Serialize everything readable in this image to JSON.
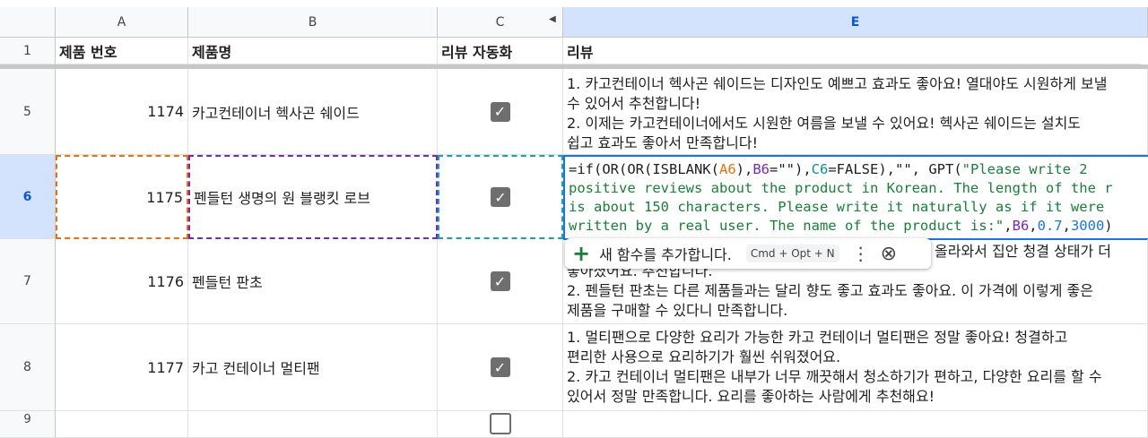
{
  "columns": {
    "a": "A",
    "b": "B",
    "c": "C",
    "e": "E"
  },
  "header_row": {
    "num": "1",
    "product_no": "제품 번호",
    "product_name": "제품명",
    "auto_review": "리뷰 자동화",
    "review": "리뷰"
  },
  "rows": [
    {
      "num": "5",
      "product_no": "1174",
      "product_name": "카고컨테이너 헥사곤 쉐이드",
      "checked": true,
      "review_lines": [
        "1. 카고컨테이너 헥사곤 쉐이드는 디자인도 예쁘고 효과도 좋아요! 열대야도 시원하게 보낼",
        "수 있어서 추천합니다!",
        "2. 이제는 카고컨테이너에서도 시원한 여름을 보낼 수 있어요! 헥사곤 쉐이드는 설치도",
        "쉽고 효과도 좋아서 만족합니다!"
      ]
    },
    {
      "num": "6",
      "product_no": "1175",
      "product_name": "펜들턴 생명의 원 블랭킷 로브",
      "checked": true
    },
    {
      "num": "7",
      "product_no": "1176",
      "product_name": "펜들턴 판초",
      "checked": true,
      "review_lines": [
        "올라와서 집안 청결 상태가 더",
        "좋아졌어요. 추천합니다.",
        "2. 펜들턴 판초는 다른 제품들과는 달리 향도 좋고 효과도 좋아요. 이 가격에 이렇게 좋은",
        "제품을 구매할 수 있다니 만족합니다."
      ]
    },
    {
      "num": "8",
      "product_no": "1177",
      "product_name": "카고 컨테이너 멀티팬",
      "checked": true,
      "review_lines": [
        "1. 멀티팬으로 다양한 요리가 가능한 카고 컨테이너 멀티팬은 정말 좋아요! 청결하고",
        "편리한 사용으로 요리하기가 훨씬 쉬워졌어요.",
        "2. 카고 컨테이너 멀티팬은 내부가 너무 깨끗해서 청소하기가 편하고, 다양한 요리를 할 수",
        "있어서 정말 만족합니다. 요리를 좋아하는 사람에게 추천해요!"
      ]
    },
    {
      "num": "9",
      "checked": false
    }
  ],
  "formula": {
    "l1_a": "=if(OR(OR(ISBLANK(",
    "l1_ref1": "A6",
    "l1_b": "),",
    "l1_ref2": "B6",
    "l1_c": "=\"\"),",
    "l1_ref3": "C6",
    "l1_d": "=FALSE),\"\", GPT(",
    "l1_str": "\"Please write 2",
    "l2": "positive reviews about the product in Korean. The length of the r",
    "l3": "is about 150 characters. Please write it naturally as if it were",
    "l4_str": "written by a real user. The name of the product is:\"",
    "l4_a": ",",
    "l4_ref": "B6",
    "l4_b": ",",
    "l4_n1": "0.7",
    "l4_c": ",",
    "l4_n2": "3000",
    "l4_d": ")"
  },
  "suggestion": {
    "plus": "+",
    "label": "새 함수를 추가합니다.",
    "shortcut": "Cmd + Opt + N",
    "more": "⋮",
    "close": "⊗"
  },
  "colors": {
    "selection_blue": "#1a73e8",
    "ref_orange": "#e8710a",
    "ref_purple": "#7627bb",
    "ref_teal": "#12a4af",
    "string_green": "#188038"
  }
}
